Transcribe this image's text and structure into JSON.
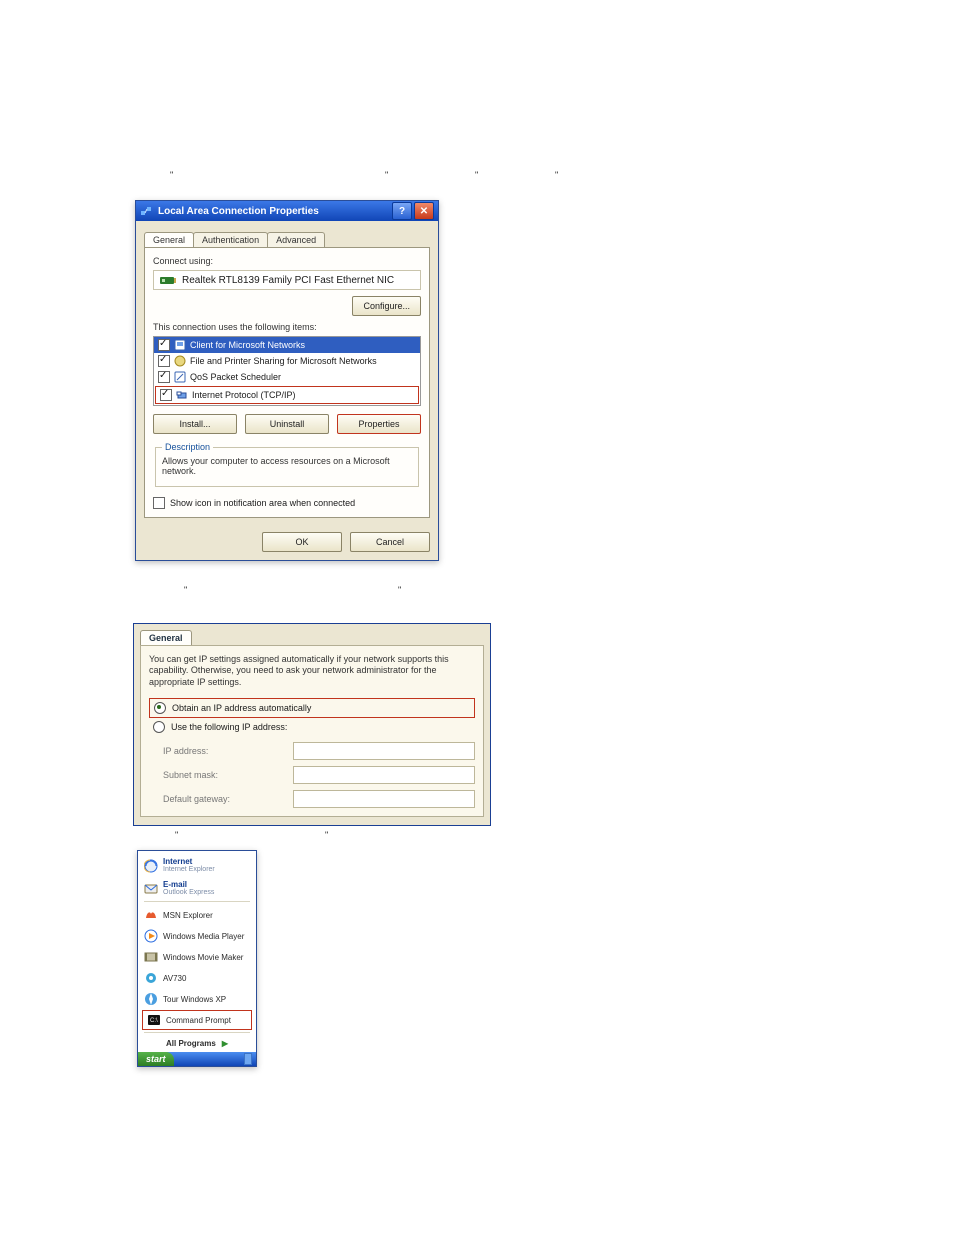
{
  "captions": {
    "cap1_left": "\"",
    "cap1_middle": "\"",
    "cap1b_left": "\"",
    "cap1b_right": "\"",
    "cap2_left": "\"",
    "cap2_right": "\"",
    "cap3_left": "\"",
    "cap3_right": "\""
  },
  "dialog1": {
    "title": "Local Area Connection Properties",
    "tabs": [
      "General",
      "Authentication",
      "Advanced"
    ],
    "connect_using_label": "Connect using:",
    "adapter": "Realtek RTL8139 Family PCI Fast Ethernet NIC",
    "configure_btn": "Configure...",
    "uses_label": "This connection uses the following items:",
    "items": [
      {
        "label": "Client for Microsoft Networks",
        "selected": true
      },
      {
        "label": "File and Printer Sharing for Microsoft Networks",
        "selected": false
      },
      {
        "label": "QoS Packet Scheduler",
        "selected": false
      },
      {
        "label": "Internet Protocol (TCP/IP)",
        "selected": false
      }
    ],
    "install_btn": "Install...",
    "uninstall_btn": "Uninstall",
    "properties_btn": "Properties",
    "description_legend": "Description",
    "description_text": "Allows your computer to access resources on a Microsoft network.",
    "show_icon_checkbox": "Show icon in notification area when connected",
    "ok_btn": "OK",
    "cancel_btn": "Cancel"
  },
  "dialog2": {
    "tab": "General",
    "desc": "You can get IP settings assigned automatically if your network supports this capability. Otherwise, you need to ask your network administrator for the appropriate IP settings.",
    "radio_auto": "Obtain an IP address automatically",
    "radio_manual": "Use the following IP address:",
    "ip_label": "IP address:",
    "subnet_label": "Subnet mask:",
    "gateway_label": "Default gateway:"
  },
  "startmenu": {
    "internet_main": "Internet",
    "internet_sub": "Internet Explorer",
    "email_main": "E-mail",
    "email_sub": "Outlook Express",
    "items": [
      "MSN Explorer",
      "Windows Media Player",
      "Windows Movie Maker",
      "AV730",
      "Tour Windows XP"
    ],
    "cmd": "Command Prompt",
    "all_programs": "All Programs",
    "start": "start"
  }
}
